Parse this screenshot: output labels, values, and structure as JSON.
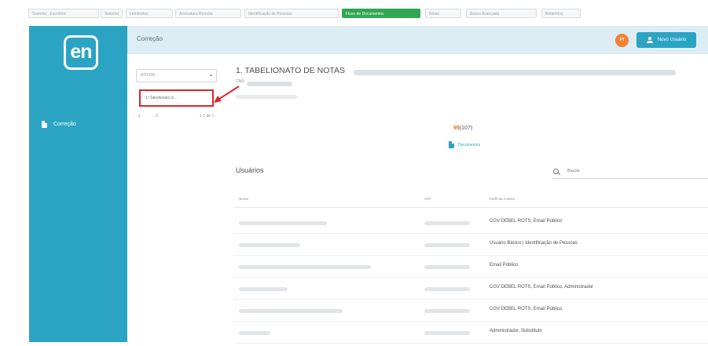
{
  "tabs": [
    "Sistema · Escritório",
    "Sistema",
    "Lembretes",
    "Assinatura Remota",
    "Identificação de Pessoas",
    "Fluxo de Documentos",
    "Notas",
    "Busca Avançada",
    "Relatórios"
  ],
  "active_tab_index": 5,
  "sidebar": {
    "logo": "en",
    "items": [
      {
        "label": "Correção",
        "icon": "document-icon"
      }
    ]
  },
  "topbar": {
    "title": "Correção",
    "avatar_initials": "FT",
    "user_button_label": "Novo Usuário"
  },
  "filter": {
    "selected": "ATIVOS"
  },
  "nav_list": {
    "selected_item": "1º Tabelionato d..."
  },
  "pager": {
    "first": "1",
    "second": "2",
    "range": "1-1 de 1"
  },
  "detail": {
    "title": "1. TABELIONATO DE NOTAS",
    "subtitle_label": "CNS:",
    "count_number": "95",
    "count_total": "(107)",
    "documents_link": "Documentos"
  },
  "users": {
    "title": "Usuários",
    "search_placeholder": "Buscar",
    "columns": [
      "Nome",
      "CPF",
      "Perfil de Acesso"
    ],
    "rows": [
      {
        "profile": "CGV DEBEL ROTS, Email Público"
      },
      {
        "profile": "Usuário Básico | Identificação de Pessoas"
      },
      {
        "profile": "Email Público"
      },
      {
        "profile": "CGV DEBEL ROTS, Email Público, Administrador"
      },
      {
        "profile": "CGV DEBEL ROTS, Email Público"
      },
      {
        "profile": "Administrador, Substituto"
      }
    ]
  },
  "colors": {
    "accent": "#2ba4c3",
    "active_tab": "#2fa84f",
    "highlight_border": "#d9262c",
    "count_number": "#e8682a",
    "avatar": "#f08232"
  }
}
